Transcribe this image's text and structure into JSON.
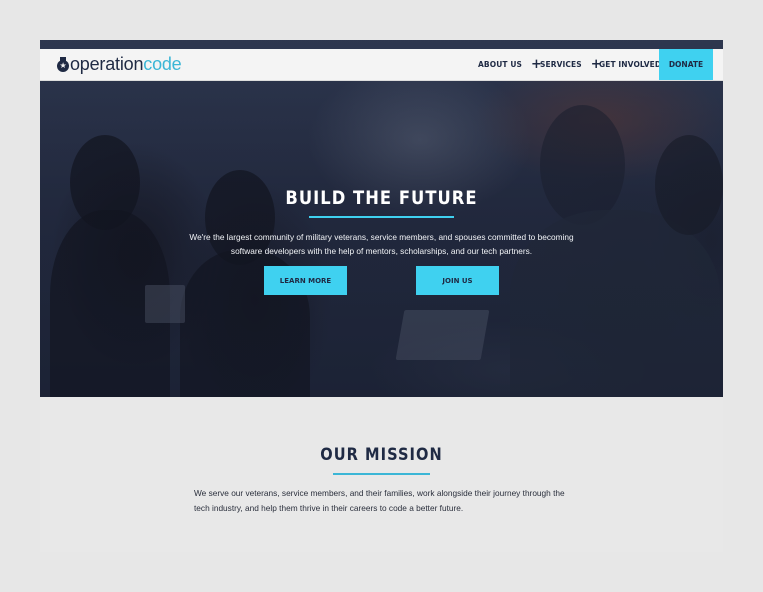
{
  "brand": {
    "logo_part1": "operation",
    "logo_part2": "code"
  },
  "nav": {
    "items": [
      {
        "label": "ABOUT US",
        "expand": "+"
      },
      {
        "label": "SERVICES",
        "expand": "+"
      },
      {
        "label": "GET INVOLVED",
        "expand": "+"
      }
    ],
    "donate": "DONATE"
  },
  "hero": {
    "title": "BUILD THE FUTURE",
    "subtitle": "We're the largest community of military veterans, service members, and spouses committed to becoming software developers with the help of mentors, scholarships, and our tech partners.",
    "learn_more": "LEARN MORE",
    "join_us": "JOIN US"
  },
  "mission": {
    "title": "OUR MISSION",
    "text": "We serve our veterans, service members, and their families, work alongside their journey through the tech industry, and help them thrive in their careers to code a better future."
  },
  "colors": {
    "accent": "#3fd1f0",
    "navy": "#1f2a44",
    "brand_blue": "#3bb6d6"
  }
}
